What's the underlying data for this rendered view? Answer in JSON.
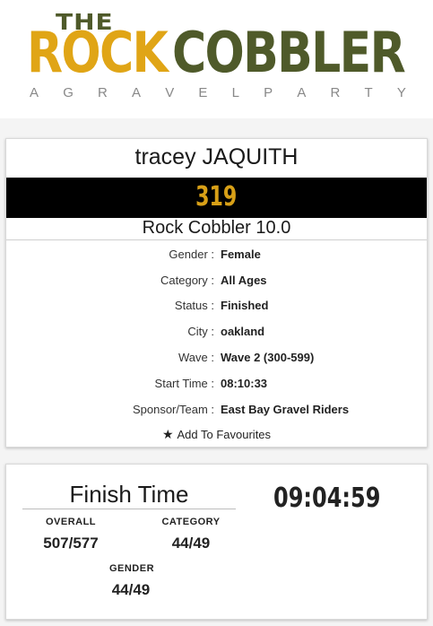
{
  "logo": {
    "the": "THE",
    "rock": "ROCK",
    "cobbler": "COBBLER",
    "tagline": [
      "A",
      "G",
      "R",
      "A",
      "V",
      "E",
      "L",
      "P",
      "A",
      "R",
      "T",
      "Y"
    ]
  },
  "athlete": {
    "name": "tracey JAQUITH",
    "bib": "319",
    "event": "Rock Cobbler 10.0"
  },
  "details": [
    {
      "label": "Gender :",
      "value": "Female"
    },
    {
      "label": "Category :",
      "value": "All Ages"
    },
    {
      "label": "Status :",
      "value": "Finished"
    },
    {
      "label": "City :",
      "value": "oakland"
    },
    {
      "label": "Wave :",
      "value": "Wave 2 (300-599)"
    },
    {
      "label": "Start Time :",
      "value": "08:10:33"
    },
    {
      "label": "Sponsor/Team :",
      "value": "East Bay Gravel Riders"
    }
  ],
  "favourites": {
    "label": "Add To Favourites",
    "icon": "star-icon"
  },
  "finish": {
    "title": "Finish Time",
    "time": "09:04:59",
    "overall_label": "OVERALL",
    "overall_value": "507/577",
    "category_label": "CATEGORY",
    "category_value": "44/49",
    "gender_label": "GENDER",
    "gender_value": "44/49"
  },
  "colors": {
    "brand_gold": "#e0a516",
    "brand_olive": "#4f5a2a",
    "bib_bg": "#000000",
    "bib_text": "#d8a017"
  }
}
